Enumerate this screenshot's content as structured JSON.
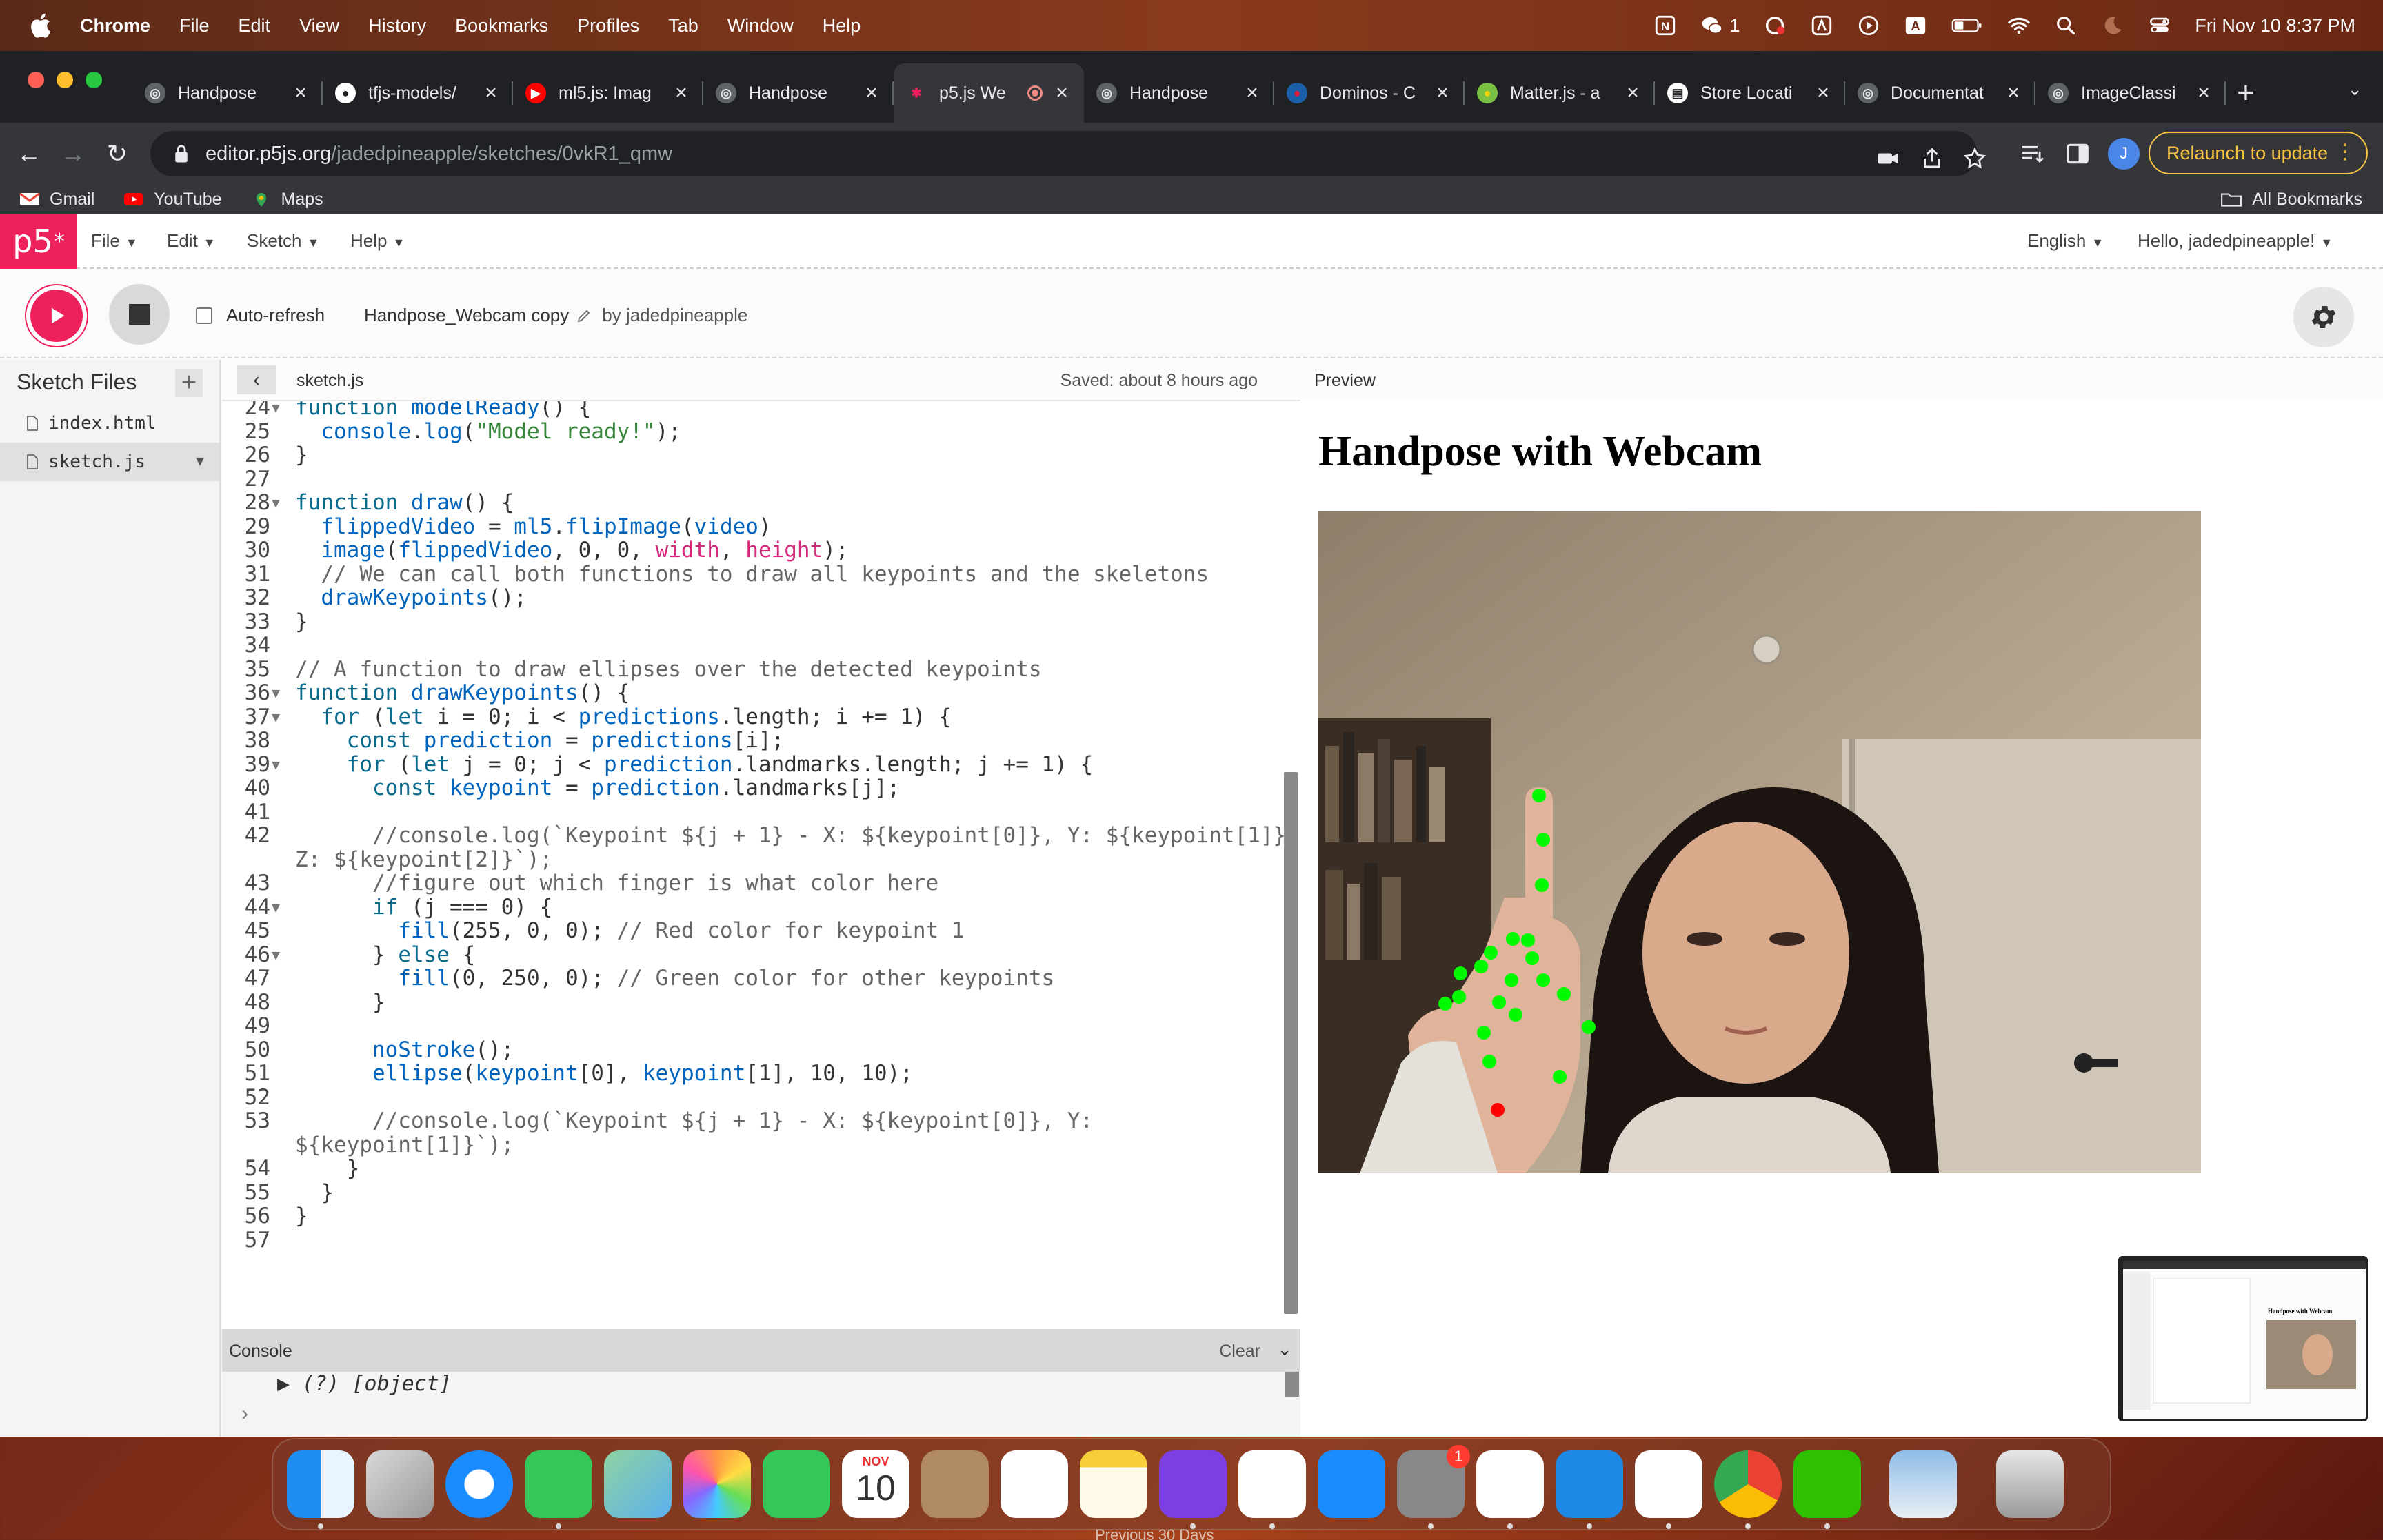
{
  "menubar": {
    "app": "Chrome",
    "items": [
      "File",
      "Edit",
      "View",
      "History",
      "Bookmarks",
      "Profiles",
      "Tab",
      "Window",
      "Help"
    ],
    "wechat_count": "1",
    "clock": "Fri Nov 10  8:37 PM"
  },
  "tabs": [
    {
      "title": "Handpose",
      "icon": "globe-icon"
    },
    {
      "title": "tfjs-models/",
      "icon": "github-icon"
    },
    {
      "title": "ml5.js: Imag",
      "icon": "youtube-icon"
    },
    {
      "title": "Handpose",
      "icon": "globe-icon"
    },
    {
      "title": "p5.js We",
      "icon": "p5-icon",
      "active": true
    },
    {
      "title": "Handpose",
      "icon": "globe-icon"
    },
    {
      "title": "Dominos - C",
      "icon": "dominos-icon"
    },
    {
      "title": "Matter.js - a",
      "icon": "matter-icon"
    },
    {
      "title": "Store Locati",
      "icon": "store-icon"
    },
    {
      "title": "Documentat",
      "icon": "globe-icon"
    },
    {
      "title": "ImageClassi",
      "icon": "globe-icon"
    }
  ],
  "omnibox": {
    "host": "editor.p5js.org",
    "path": "/jadedpineapple/sketches/0vkR1_qmw",
    "profile_initial": "J",
    "relaunch": "Relaunch to update"
  },
  "bookmarks": {
    "items": [
      "Gmail",
      "YouTube",
      "Maps"
    ],
    "all": "All Bookmarks"
  },
  "p5nav": {
    "logo": "p5",
    "menus": [
      "File",
      "Edit",
      "Sketch",
      "Help"
    ],
    "language": "English",
    "greeting": "Hello, jadedpineapple!"
  },
  "p5bar": {
    "auto_refresh": "Auto-refresh",
    "sketch_name": "Handpose_Webcam copy",
    "by": "by jadedpineapple"
  },
  "sidebar": {
    "title": "Sketch Files",
    "files": [
      "index.html",
      "sketch.js"
    ]
  },
  "codehead": {
    "file": "sketch.js",
    "saved": "Saved: about 8 hours ago"
  },
  "code": {
    "lines": [
      {
        "n": "24",
        "f": true,
        "t": "function modelReady() {"
      },
      {
        "n": "25",
        "f": false,
        "t": "  console.log(\"Model ready!\");"
      },
      {
        "n": "26",
        "f": false,
        "t": "}"
      },
      {
        "n": "27",
        "f": false,
        "t": ""
      },
      {
        "n": "28",
        "f": true,
        "t": "function draw() {"
      },
      {
        "n": "29",
        "f": false,
        "t": "  flippedVideo = ml5.flipImage(video)"
      },
      {
        "n": "30",
        "f": false,
        "t": "  image(flippedVideo, 0, 0, width, height);"
      },
      {
        "n": "31",
        "f": false,
        "t": "  // We can call both functions to draw all keypoints and the skeletons"
      },
      {
        "n": "32",
        "f": false,
        "t": "  drawKeypoints();"
      },
      {
        "n": "33",
        "f": false,
        "t": "}"
      },
      {
        "n": "34",
        "f": false,
        "t": ""
      },
      {
        "n": "35",
        "f": false,
        "t": "// A function to draw ellipses over the detected keypoints"
      },
      {
        "n": "36",
        "f": true,
        "t": "function drawKeypoints() {"
      },
      {
        "n": "37",
        "f": true,
        "t": "  for (let i = 0; i < predictions.length; i += 1) {"
      },
      {
        "n": "38",
        "f": false,
        "t": "    const prediction = predictions[i];"
      },
      {
        "n": "39",
        "f": true,
        "t": "    for (let j = 0; j < prediction.landmarks.length; j += 1) {"
      },
      {
        "n": "40",
        "f": false,
        "t": "      const keypoint = prediction.landmarks[j];"
      },
      {
        "n": "41",
        "f": false,
        "t": ""
      },
      {
        "n": "42",
        "f": false,
        "t": "      //console.log(`Keypoint ${j + 1} - X: ${keypoint[0]}, Y: ${keypoint[1]},"
      },
      {
        "n": "",
        "f": false,
        "t": "Z: ${keypoint[2]}`);"
      },
      {
        "n": "43",
        "f": false,
        "t": "      //figure out which finger is what color here"
      },
      {
        "n": "44",
        "f": true,
        "t": "      if (j === 0) {"
      },
      {
        "n": "45",
        "f": false,
        "t": "        fill(255, 0, 0); // Red color for keypoint 1"
      },
      {
        "n": "46",
        "f": true,
        "t": "      } else {"
      },
      {
        "n": "47",
        "f": false,
        "t": "        fill(0, 250, 0); // Green color for other keypoints"
      },
      {
        "n": "48",
        "f": false,
        "t": "      }"
      },
      {
        "n": "49",
        "f": false,
        "t": ""
      },
      {
        "n": "50",
        "f": false,
        "t": "      noStroke();"
      },
      {
        "n": "51",
        "f": false,
        "t": "      ellipse(keypoint[0], keypoint[1], 10, 10);"
      },
      {
        "n": "52",
        "f": false,
        "t": ""
      },
      {
        "n": "53",
        "f": false,
        "t": "      //console.log(`Keypoint ${j + 1} - X: ${keypoint[0]}, Y:"
      },
      {
        "n": "",
        "f": false,
        "t": "${keypoint[1]}`);"
      },
      {
        "n": "54",
        "f": false,
        "t": "    }"
      },
      {
        "n": "55",
        "f": false,
        "t": "  }"
      },
      {
        "n": "56",
        "f": false,
        "t": "}"
      },
      {
        "n": "57",
        "f": false,
        "t": ""
      }
    ]
  },
  "console": {
    "title": "Console",
    "clear": "Clear",
    "entry": "▶ (?) [object]"
  },
  "preview": {
    "label": "Preview",
    "heading": "Handpose with Webcam"
  },
  "below_dock_text": "Previous 30 Days",
  "dock": {
    "calendar_month": "NOV",
    "calendar_day": "10",
    "settings_badge": "1"
  }
}
